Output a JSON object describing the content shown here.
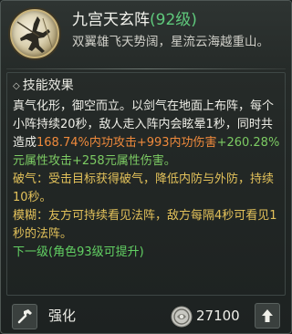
{
  "skill": {
    "name": "九宫天玄阵",
    "level": "(92级)",
    "subtitle": "双翼雄飞天势阔，星流云海越重山。"
  },
  "effects": {
    "header": "技能效果",
    "p1": {
      "s1": "真气化形，御空而立。以剑气在地面上布阵，每个小阵持续20秒，敌人走入阵内会眩晕1秒，同时共造成",
      "s2": "168.74%内功攻击+993内功伤害",
      "s3": "+260.28%元属性攻击+258元属性伤害。"
    },
    "p2": "破气：受击目标获得破气，降低内防与外防，持续10秒。",
    "p3": "模糊：友方可持续看见法阵，敌方每隔4秒可看见1秒的法阵。",
    "next_level": "下一级(角色93级可提升)"
  },
  "footer": {
    "upgrade_label": "强化",
    "cost": "27100"
  },
  "colors": {
    "level_green": "#5fc97c",
    "damage_orange": "#ef8a3c",
    "element_green": "#7ccb63",
    "status_yellow": "#e2c15a"
  },
  "icons": {
    "skill": "sword-dancer-skill-icon",
    "section": "diamond-bullet-icon",
    "upgrade": "hammer-icon",
    "currency": "coin-icon",
    "arrow": "arrow-up-icon"
  }
}
